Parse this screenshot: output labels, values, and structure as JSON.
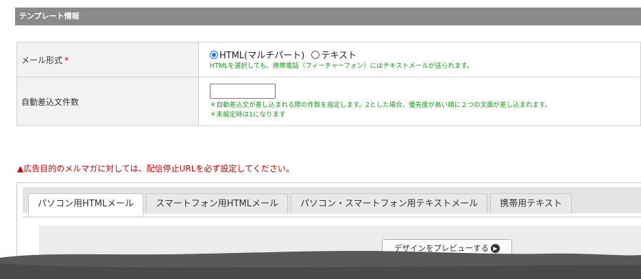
{
  "section": {
    "title": "テンプレート情報"
  },
  "form": {
    "mail_format": {
      "label": "メール形式",
      "required_mark": "*",
      "options": [
        {
          "label": "HTML(マルチパート)",
          "selected": true
        },
        {
          "label": "テキスト",
          "selected": false
        }
      ],
      "note": "HTMLを選択しても、携帯電話（フィーチャーフォン）にはテキストメールが送られます。"
    },
    "auto_insert_count": {
      "label": "自動差込文件数",
      "value": "",
      "note1": "＊自動差込文が差し込まれる際の件数を指定します。2とした場合、優先度が高い順に２つの文面が差し込まれます。",
      "note2": "＊未設定時は1になります"
    }
  },
  "warning": "▲広告目的のメルマガに対しては、配信停止URLを必ず設定してください。",
  "tabs": [
    {
      "label": "パソコン用HTMLメール",
      "active": true
    },
    {
      "label": "スマートフォン用HTMLメール",
      "active": false
    },
    {
      "label": "パソコン・スマートフォン用テキストメール",
      "active": false
    },
    {
      "label": "携帯用テキスト",
      "active": false
    }
  ],
  "preview": {
    "button_label": "デザインをプレビューする"
  },
  "colors": {
    "header_bg": "#8a8a8a",
    "required": "#d00000",
    "note_green": "#1a9a1a",
    "warning": "#d00000",
    "radio_selected": "#1a73e8"
  },
  "icons": {
    "preview_arrow": "chevron-right-circle-icon"
  }
}
